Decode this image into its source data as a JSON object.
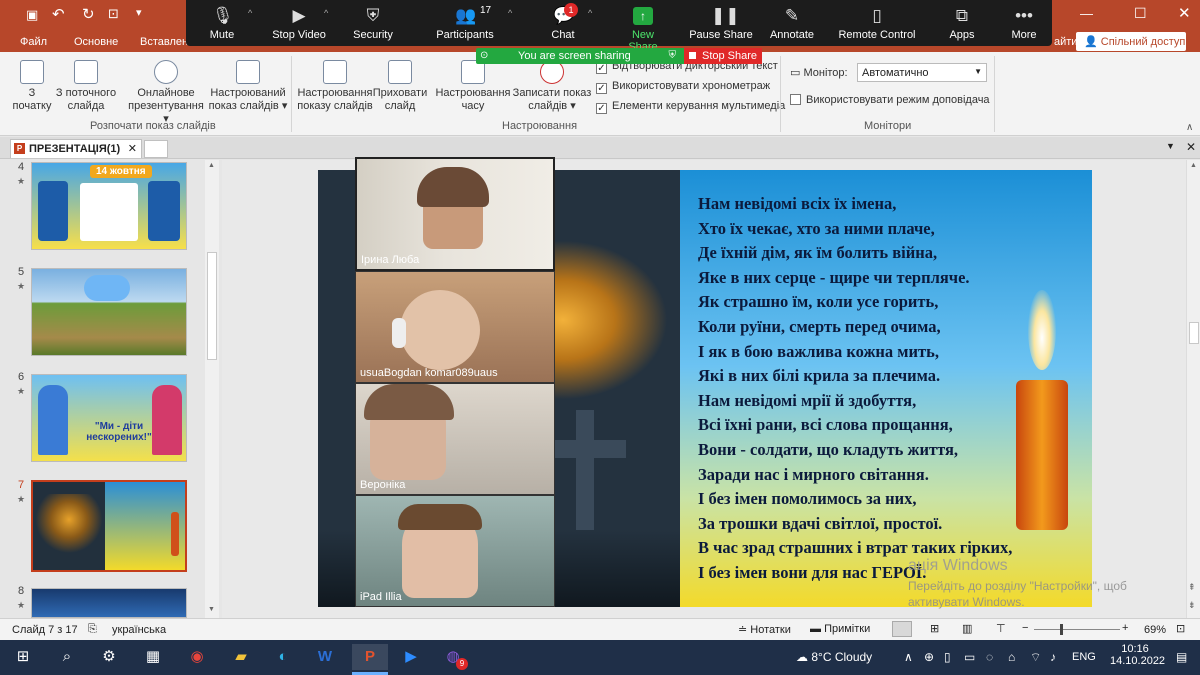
{
  "app": {
    "share_button": "Спільний доступ",
    "partial_right_label": "айти",
    "tabs": [
      "Файл",
      "Основне",
      "Вставлення"
    ]
  },
  "ribbon": {
    "buttons": [
      {
        "label": "З\nпочатку"
      },
      {
        "label": "З поточного\nслайда"
      },
      {
        "label": "Онлайнове\nпрезентування ▾"
      },
      {
        "label": "Настроюваний\nпоказ слайдів ▾"
      },
      {
        "label": "Настроювання\nпоказу слайдів"
      },
      {
        "label": "Приховати\nслайд"
      },
      {
        "label": "Настроювання\nчасу"
      },
      {
        "label": "Записати показ\nслайдів ▾"
      }
    ],
    "checkboxes": [
      {
        "label": "Відтворювати дикторський текст",
        "checked": true
      },
      {
        "label": "Використовувати хронометраж",
        "checked": true
      },
      {
        "label": "Елементи керування мультимедіа",
        "checked": true
      }
    ],
    "monitor_label": "Монітор:",
    "monitor_value": "Автоматично",
    "presenter_view_label": "Використовувати режим доповідача",
    "groups": [
      "Розпочати показ слайдів",
      "Настроювання",
      "Монітори"
    ]
  },
  "zoom": {
    "mute": "Mute",
    "stop_video": "Stop Video",
    "security": "Security",
    "participants": "Participants",
    "participants_count": "17",
    "chat": "Chat",
    "chat_badge": "1",
    "new_share": "New Share",
    "pause_share": "Pause Share",
    "annotate": "Annotate",
    "remote_control": "Remote Control",
    "apps": "Apps",
    "more": "More",
    "sharing_banner": "You are screen sharing",
    "stop_share": "Stop Share",
    "participants_tiles": [
      {
        "name": "Ірина Люба"
      },
      {
        "name": "usuaBogdan komar089uaus"
      },
      {
        "name": "Вероніка"
      },
      {
        "name": "iPad Illia"
      }
    ]
  },
  "document": {
    "tab_title": "ПРЕЗЕНТАЦІЯ(1)",
    "slide_numbers": [
      "4",
      "5",
      "6",
      "7",
      "8"
    ],
    "active_slide": "7",
    "thumb4_title": "14 жовтня",
    "thumb6_text": "\"Ми - діти нескорених!\""
  },
  "slide": {
    "poem_lines": [
      "Нам невідомі всіх їх імена,",
      "Хто їх чекає, хто за ними плаче,",
      "Де їхній дім, як їм болить війна,",
      "Яке в них серце - щире чи терпляче.",
      "Як страшно їм, коли усе горить,",
      "Коли руїни, смерть перед очима,",
      "І як в бою важлива кожна мить,",
      "Які в них білі крила за плечима.",
      "Нам невідомі мрії й здобуття,",
      "Всі їхні рани, всі слова прощання,",
      "Вони - солдати, що кладуть життя,",
      "Заради нас і мирного світання.",
      "І без імен помолимось за них,",
      "За трошки вдачі світлої, простої.",
      "В час зрад страшних і втрат таких гірких,",
      "І без імен вони для нас ГЕРОЇ."
    ]
  },
  "watermark": {
    "line1": "ація Windows",
    "line2": "Перейдіть до розділу \"Настройки\", щоб\nактивувати Windows."
  },
  "statusbar": {
    "slide_info": "Слайд 7 з 17",
    "language": "українська",
    "notes": "Нотатки",
    "comments": "Примітки",
    "zoom": "69%"
  },
  "taskbar": {
    "weather": "8°C  Cloudy",
    "lang": "ENG",
    "time": "10:16",
    "date": "14.10.2022",
    "viber_badge": "9"
  },
  "colors": {
    "powerpoint_accent": "#b7472a",
    "zoom_bar": "#1c1c1c",
    "share_green": "#23a840",
    "stop_red": "#e02828",
    "taskbar": "#1f2f48"
  }
}
